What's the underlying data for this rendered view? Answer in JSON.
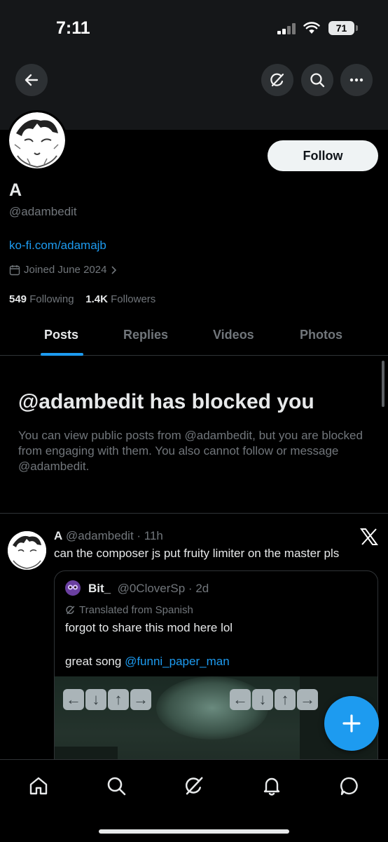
{
  "status_bar": {
    "time": "7:11",
    "battery": "71"
  },
  "header": {
    "back_icon": "arrow-left-icon",
    "grok_icon": "grok-icon",
    "search_icon": "search-icon",
    "more_icon": "more-horizontal-icon"
  },
  "profile": {
    "display_name": "A",
    "handle": "@adambedit",
    "link": "ko-fi.com/adamajb",
    "joined": "Joined June 2024",
    "following_count": "549",
    "following_label": "Following",
    "followers_count": "1.4K",
    "followers_label": "Followers",
    "follow_button": "Follow"
  },
  "tabs": [
    {
      "label": "Posts",
      "active": true
    },
    {
      "label": "Replies",
      "active": false
    },
    {
      "label": "Videos",
      "active": false
    },
    {
      "label": "Photos",
      "active": false
    }
  ],
  "blocked": {
    "title": "@adambedit has blocked you",
    "text": "You can view public posts from @adambedit, but you are blocked from engaging with them. You also cannot follow or message @adambedit."
  },
  "tweet": {
    "name": "A",
    "handle_time": "@adambedit · 11h",
    "text": "can the composer js put fruity limiter on the master pls",
    "quote": {
      "name": "Bit_",
      "handle_time": "@0CloverSp · 2d",
      "translated": "Translated from Spanish",
      "line1": "forgot to share this mod here lol",
      "line2_prefix": "great song ",
      "mention": "@funni_paper_man"
    }
  },
  "bottom_nav": [
    "home-icon",
    "search-icon",
    "grok-icon",
    "notifications-icon",
    "messages-icon"
  ],
  "colors": {
    "accent": "#1d9bf0",
    "background": "#000000",
    "secondary_text": "#71767b"
  }
}
